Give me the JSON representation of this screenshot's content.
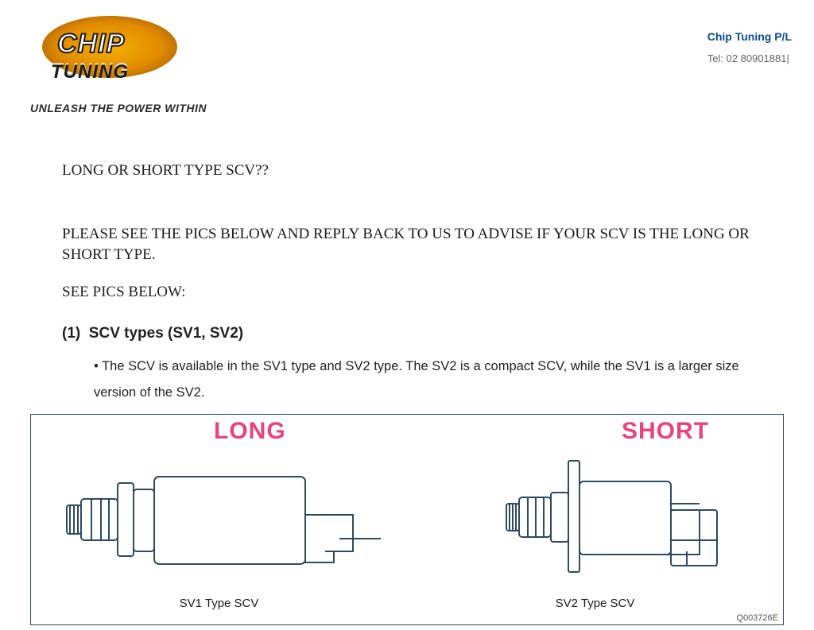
{
  "header": {
    "company_name": "Chip Tuning P/L",
    "phone_line": "Tel: 02 80901881|",
    "logo_word_top": "CHIP",
    "logo_word_bottom": "TUNING",
    "tagline": "UNLEASH THE POWER WITHIN"
  },
  "body": {
    "question": "LONG OR SHORT TYPE SCV??",
    "instruction": "PLEASE SEE THE PICS BELOW AND REPLY BACK TO US TO ADVISE IF YOUR SCV IS THE LONG OR SHORT TYPE.",
    "see_pics": "SEE PICS BELOW:",
    "section_number": "(1)",
    "section_title": "SCV types (SV1, SV2)",
    "bullet_text": "The SCV is available in the SV1 type and SV2 type. The SV2 is a compact SCV, while the SV1 is a larger size version of the SV2."
  },
  "figure": {
    "left_label": "LONG",
    "right_label": "SHORT",
    "left_caption": "SV1 Type SCV",
    "right_caption": "SV2 Type SCV",
    "code": "Q003726E"
  }
}
